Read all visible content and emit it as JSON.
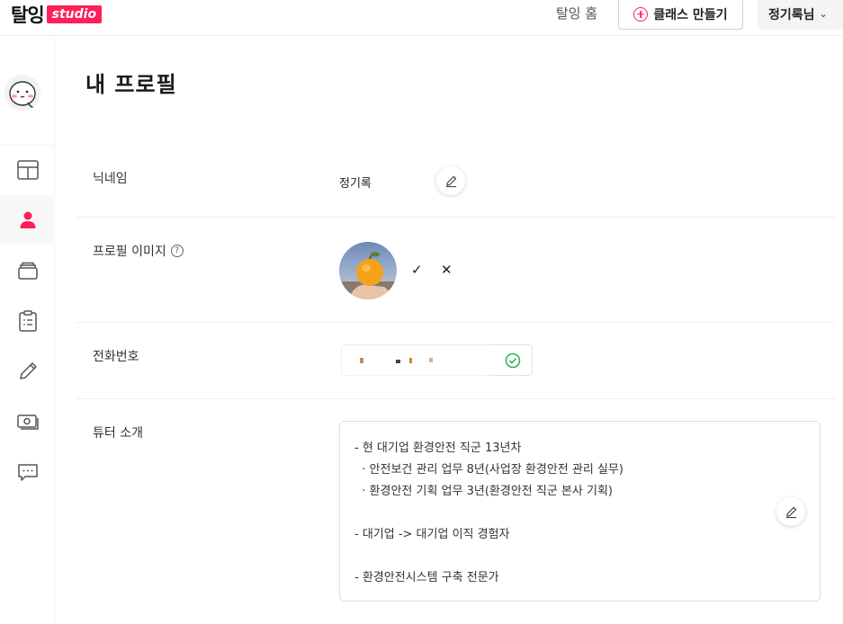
{
  "header": {
    "logo_main": "탈잉",
    "logo_badge": "studio",
    "home_link": "탈잉 홈",
    "create_button": "클래스 만들기",
    "user_name": "정기록님",
    "user_chevron": "⌄"
  },
  "sidebar": {
    "items": [
      {
        "name": "dashboard",
        "icon": "layout-icon",
        "active": false
      },
      {
        "name": "profile",
        "icon": "person-icon",
        "active": true
      },
      {
        "name": "classes",
        "icon": "stack-icon",
        "active": false
      },
      {
        "name": "clipboard",
        "icon": "clipboard-icon",
        "active": false
      },
      {
        "name": "write",
        "icon": "pencil-icon",
        "active": false
      },
      {
        "name": "settlement",
        "icon": "money-icon",
        "active": false
      },
      {
        "name": "messages",
        "icon": "chat-icon",
        "active": false
      }
    ]
  },
  "main": {
    "title": "내 프로필",
    "nickname": {
      "label": "닉네임",
      "value": "정기록"
    },
    "profile_image": {
      "label": "프로필 이미지",
      "help": "?",
      "confirm": "✓",
      "cancel": "✕"
    },
    "phone": {
      "label": "전화번호"
    },
    "intro": {
      "label": "튜터 소개",
      "lines": [
        "- 현 대기업 환경안전 직군 13년차",
        "  · 안전보건 관리 업무 8년(사업장 환경안전 관리 실무)",
        "  · 환경안전 기획 업무 3년(환경안전 직군 본사 기획)",
        "",
        "- 대기업 -> 대기업 이직 경험자",
        "",
        "- 환경안전시스템 구축 전문가"
      ]
    }
  },
  "colors": {
    "accent": "#ff1f5a",
    "verified": "#2bb24c",
    "active_bg": "#f7f7f7"
  }
}
